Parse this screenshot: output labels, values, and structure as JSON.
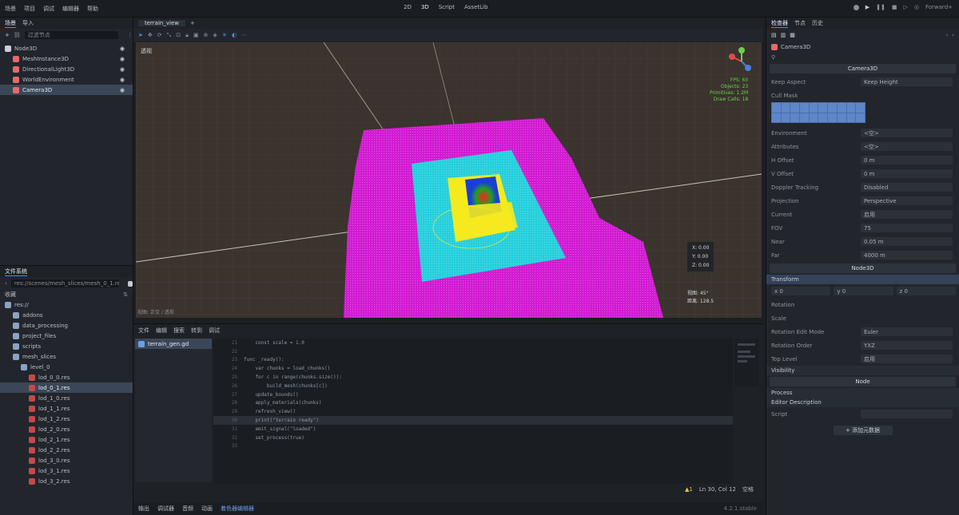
{
  "top_menu": {
    "items": [
      "场景",
      "项目",
      "调试",
      "编辑器",
      "帮助"
    ],
    "center": [
      "2D",
      "3D",
      "Script",
      "AssetLib"
    ],
    "right_label": "Forward+"
  },
  "scene_dock": {
    "tabs": [
      "场景",
      "导入"
    ],
    "filter_placeholder": "过滤节点",
    "tree": [
      {
        "label": "Node3D",
        "depth": 0,
        "icon_color": "#c9d0d8",
        "selected": false
      },
      {
        "label": "MeshInstance3D",
        "depth": 1,
        "icon_color": "#e46a6a",
        "selected": false
      },
      {
        "label": "DirectionalLight3D",
        "depth": 1,
        "icon_color": "#e46a6a",
        "selected": false
      },
      {
        "label": "WorldEnvironment",
        "depth": 1,
        "icon_color": "#e46a6a",
        "selected": false
      },
      {
        "label": "Camera3D",
        "depth": 1,
        "icon_color": "#e46a6a",
        "selected": true
      }
    ]
  },
  "fs_dock": {
    "title": "文件系统",
    "path": "res://scenes/mesh_slices/mesh_0_1.res",
    "favorites_label": "收藏",
    "tree": [
      {
        "label": "res://",
        "depth": 0,
        "kind": "folder",
        "selected": false
      },
      {
        "label": "addons",
        "depth": 1,
        "kind": "folder",
        "selected": false
      },
      {
        "label": "data_processing",
        "depth": 1,
        "kind": "folder",
        "selected": false
      },
      {
        "label": "project_files",
        "depth": 1,
        "kind": "folder",
        "selected": false
      },
      {
        "label": "scripts",
        "depth": 1,
        "kind": "folder",
        "selected": false
      },
      {
        "label": "mesh_slices",
        "depth": 1,
        "kind": "folder",
        "selected": false
      },
      {
        "label": "level_0",
        "depth": 2,
        "kind": "folder",
        "selected": false
      },
      {
        "label": "lod_0_0.res",
        "depth": 3,
        "kind": "file",
        "selected": false
      },
      {
        "label": "lod_0_1.res",
        "depth": 3,
        "kind": "file",
        "selected": true
      },
      {
        "label": "lod_1_0.res",
        "depth": 3,
        "kind": "file",
        "selected": false
      },
      {
        "label": "lod_1_1.res",
        "depth": 3,
        "kind": "file",
        "selected": false
      },
      {
        "label": "lod_1_2.res",
        "depth": 3,
        "kind": "file",
        "selected": false
      },
      {
        "label": "lod_2_0.res",
        "depth": 3,
        "kind": "file",
        "selected": false
      },
      {
        "label": "lod_2_1.res",
        "depth": 3,
        "kind": "file",
        "selected": false
      },
      {
        "label": "lod_2_2.res",
        "depth": 3,
        "kind": "file",
        "selected": false
      },
      {
        "label": "lod_3_0.res",
        "depth": 3,
        "kind": "file",
        "selected": false
      },
      {
        "label": "lod_3_1.res",
        "depth": 3,
        "kind": "file",
        "selected": false
      },
      {
        "label": "lod_3_2.res",
        "depth": 3,
        "kind": "file",
        "selected": false
      }
    ]
  },
  "scene_tabs": [
    "terrain_view",
    "+"
  ],
  "viewport": {
    "perspective_label": "透视",
    "stats": [
      "FPS: 60",
      "Objects: 23",
      "Primitives: 1.2M",
      "Draw Calls: 18"
    ],
    "corner_info": [
      "X: 0.00",
      "Y: 0.00",
      "Z: 0.00"
    ],
    "bottom_info": [
      "视图: 45°",
      "距离: 128.5"
    ],
    "footer_left": "视图: 正交 / 透视"
  },
  "script_panel": {
    "tabs": [
      "文件",
      "编辑",
      "搜索",
      "转到",
      "调试"
    ],
    "open_scripts": [
      "terrain_gen.gd"
    ],
    "code_lines": [
      {
        "n": "21",
        "text": "    const scale = 1.0"
      },
      {
        "n": "22",
        "text": ""
      },
      {
        "n": "23",
        "text": "func _ready():"
      },
      {
        "n": "24",
        "text": "    var chunks = load_chunks()"
      },
      {
        "n": "25",
        "text": "    for c in range(chunks.size()):"
      },
      {
        "n": "26",
        "text": "        build_mesh(chunks[c])"
      },
      {
        "n": "27",
        "text": "    update_bounds()"
      },
      {
        "n": "28",
        "text": "    apply_materials(chunks)"
      },
      {
        "n": "29",
        "text": "    refresh_view()"
      },
      {
        "n": "30",
        "text": "    print(\"terrain ready\")"
      },
      {
        "n": "31",
        "text": "    emit_signal(\"loaded\")"
      },
      {
        "n": "32",
        "text": "    set_process(true)"
      },
      {
        "n": "33",
        "text": ""
      }
    ],
    "highlight_line": "30",
    "status": [
      "▲1",
      "Ln 30, Col 12",
      "空格"
    ],
    "bottom_tabs": [
      "输出",
      "调试器",
      "音频",
      "动画",
      "着色器编辑器"
    ],
    "version": "4.2.1.stable"
  },
  "inspector": {
    "tabs": [
      "检查器",
      "节点",
      "历史"
    ],
    "node_name": "Camera3D",
    "section_header": "Camera3D",
    "sections": [
      {
        "k": "Keep Aspect",
        "v": "Keep Height"
      },
      {
        "k": "Cull Mask",
        "v": ""
      },
      {
        "k": "Environment",
        "v": "<空>"
      },
      {
        "k": "Attributes",
        "v": "<空>"
      },
      {
        "k": "H Offset",
        "v": "0 m"
      },
      {
        "k": "V Offset",
        "v": "0 m"
      },
      {
        "k": "Doppler Tracking",
        "v": "Disabled"
      },
      {
        "k": "Projection",
        "v": "Perspective"
      },
      {
        "k": "Current",
        "v": "启用"
      },
      {
        "k": "FOV",
        "v": "75"
      },
      {
        "k": "Near",
        "v": "0.05 m"
      },
      {
        "k": "Far",
        "v": "4000 m"
      }
    ],
    "node3d_header": "Node3D",
    "transform_label": "Transform",
    "position_row": [
      "x 0",
      "y 0",
      "z 0"
    ],
    "rotation_label": "Rotation",
    "scale_label": "Scale",
    "rotation_edit": {
      "k": "Rotation Edit Mode",
      "v": "Euler"
    },
    "rotation_order": {
      "k": "Rotation Order",
      "v": "YXZ"
    },
    "top_level": {
      "k": "Top Level",
      "v": "启用"
    },
    "visibility": "Visibility",
    "node_header": "Node",
    "process": "Process",
    "editor_description": "Editor Description",
    "script_label": "Script",
    "add_meta_button": "+ 添加元数据"
  },
  "colors": {
    "magenta": "#d21ad2",
    "cyan": "#25cfdc",
    "yellow": "#f4ea1e",
    "accent": "#4a8ee6"
  }
}
